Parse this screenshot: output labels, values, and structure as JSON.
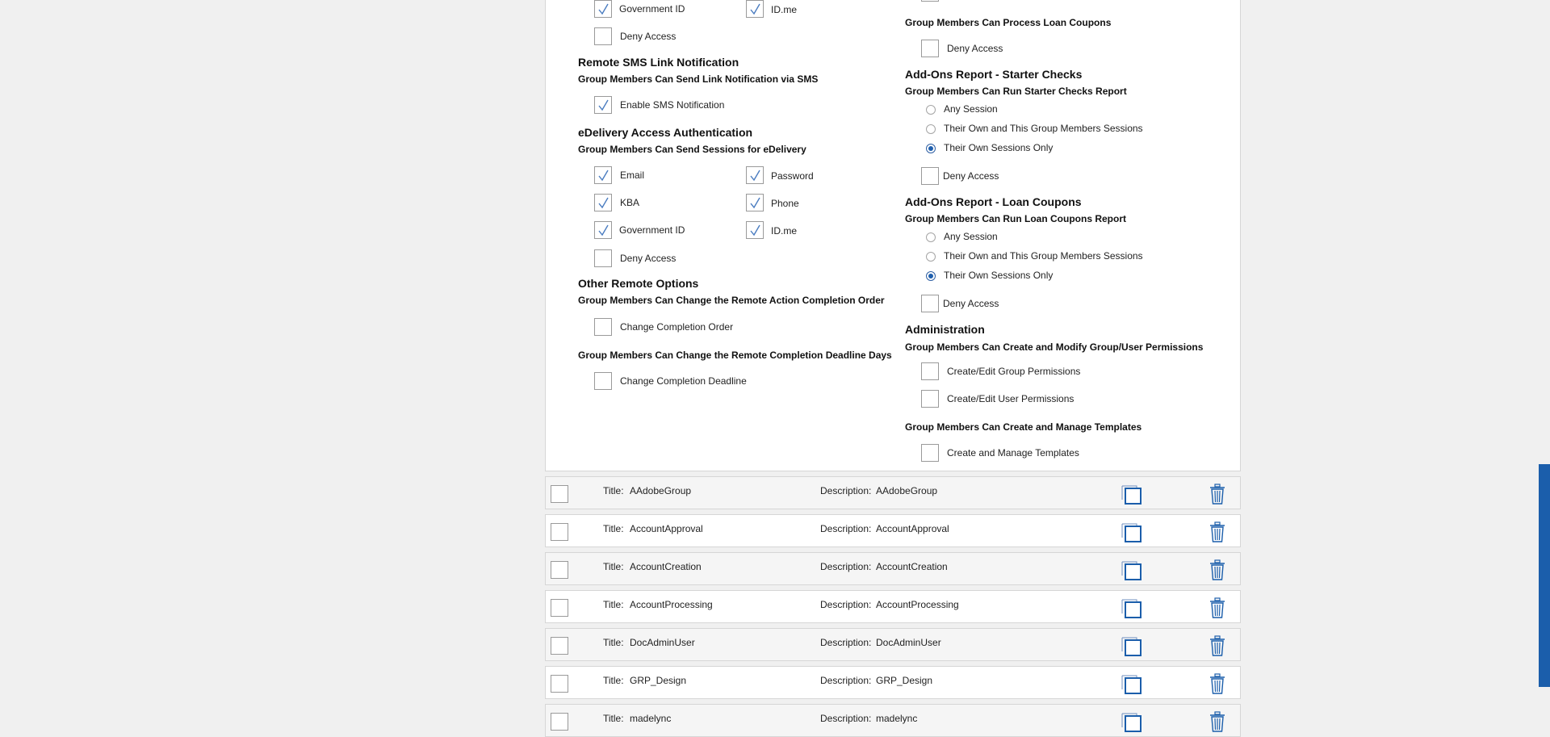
{
  "colors": {
    "accent": "#1b5eab",
    "check": "#4a7cc0",
    "panel_border": "#d6d6d6"
  },
  "left_col": {
    "auth_top": {
      "government_id": "Government ID",
      "idme": "ID.me",
      "deny": "Deny Access",
      "government_id_checked": true,
      "idme_checked": true,
      "deny_checked": false
    },
    "sms": {
      "title": "Remote SMS Link Notification",
      "subtitle": "Group Members Can Send Link Notification via SMS",
      "enable_label": "Enable SMS Notification",
      "enable_checked": true
    },
    "edelivery": {
      "title": "eDelivery Access Authentication",
      "subtitle": "Group Members Can Send Sessions for eDelivery",
      "email": "Email",
      "password": "Password",
      "kba": "KBA",
      "phone": "Phone",
      "government_id": "Government ID",
      "idme": "ID.me",
      "deny": "Deny Access"
    },
    "other": {
      "title": "Other Remote Options",
      "subtitle_order": "Group Members Can Change the Remote Action Completion Order",
      "order_label": "Change Completion Order",
      "subtitle_deadline": "Group Members Can Change the Remote Completion Deadline Days",
      "deadline_label": "Change Completion Deadline"
    }
  },
  "right_col": {
    "loan_coupons_process": {
      "subtitle": "Group Members Can Process Loan Coupons",
      "deny": "Deny Access"
    },
    "starter_checks": {
      "title": "Add-Ons Report - Starter Checks",
      "subtitle": "Group Members Can Run Starter Checks Report",
      "any": "Any Session",
      "own_group": "Their Own and This Group Members Sessions",
      "own_only": "Their Own Sessions Only",
      "selected": "own_only",
      "deny": "Deny Access"
    },
    "loan_coupons_report": {
      "title": "Add-Ons Report - Loan Coupons",
      "subtitle": "Group Members Can Run Loan Coupons Report",
      "any": "Any Session",
      "own_group": "Their Own and This Group Members Sessions",
      "own_only": "Their Own Sessions Only",
      "selected": "own_only",
      "deny": "Deny Access"
    },
    "administration": {
      "title": "Administration",
      "subtitle_perms": "Group Members Can Create and Modify Group/User Permissions",
      "group_perms": "Create/Edit Group Permissions",
      "user_perms": "Create/Edit User Permissions",
      "subtitle_templates": "Group Members Can Create and Manage Templates",
      "templates": "Create and Manage Templates"
    }
  },
  "groups": {
    "title_prefix": "Title:",
    "description_prefix": "Description:",
    "rows": [
      {
        "title": "AAdobeGroup",
        "description": "AAdobeGroup"
      },
      {
        "title": "AccountApproval",
        "description": "AccountApproval"
      },
      {
        "title": "AccountCreation",
        "description": "AccountCreation"
      },
      {
        "title": "AccountProcessing",
        "description": "AccountProcessing"
      },
      {
        "title": "DocAdminUser",
        "description": "DocAdminUser"
      },
      {
        "title": "GRP_Design",
        "description": "GRP_Design"
      },
      {
        "title": "madelync",
        "description": "madelync"
      }
    ]
  },
  "icons": {
    "copy": "copy-icon",
    "delete": "trash-icon",
    "check": "checkmark-icon"
  }
}
